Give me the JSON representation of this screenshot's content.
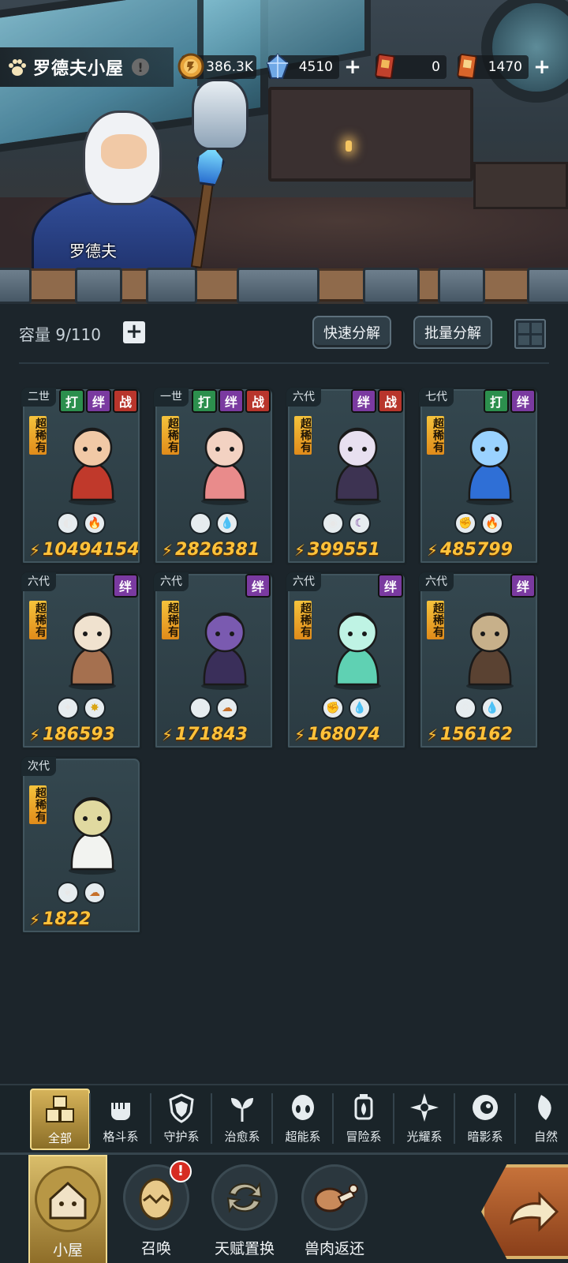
{
  "header": {
    "title": "罗德夫小屋",
    "info_mark": "!"
  },
  "npc": {
    "name": "罗德夫"
  },
  "resources": [
    {
      "icon": "gold-coin-icon",
      "value": "386.3K",
      "has_plus": false
    },
    {
      "icon": "crystal-icon",
      "value": "4510",
      "has_plus": true
    },
    {
      "icon": "red-ticket-icon",
      "value": "0",
      "has_plus": false
    },
    {
      "icon": "orange-ticket-icon",
      "value": "1470",
      "has_plus": true
    }
  ],
  "storage": {
    "label": "容量 9/110",
    "plus": "+",
    "quick_decompose": "快速分解",
    "batch_decompose": "批量分解"
  },
  "cards": [
    {
      "gen": "二世",
      "tags": [
        "打",
        "绊",
        "战"
      ],
      "rarity": "超稀有",
      "attrs": [
        "psychic",
        "fire"
      ],
      "power": "10494154",
      "art": "boy-warrior"
    },
    {
      "gen": "一世",
      "tags": [
        "打",
        "绊",
        "战"
      ],
      "rarity": "超稀有",
      "attrs": [
        "guard",
        "water"
      ],
      "power": "2826381",
      "art": "girl-mage"
    },
    {
      "gen": "六代",
      "tags": [
        "绊",
        "战"
      ],
      "rarity": "超稀有",
      "attrs": [
        "shadow",
        "dark"
      ],
      "power": "399551",
      "art": "fox"
    },
    {
      "gen": "七代",
      "tags": [
        "打",
        "绊"
      ],
      "rarity": "超稀有",
      "attrs": [
        "fist",
        "fire"
      ],
      "power": "485799",
      "art": "blue-flame"
    },
    {
      "gen": "六代",
      "tags": [
        "绊"
      ],
      "rarity": "超稀有",
      "attrs": [
        "radiant",
        "light"
      ],
      "power": "186593",
      "art": "deer"
    },
    {
      "gen": "六代",
      "tags": [
        "绊"
      ],
      "rarity": "超稀有",
      "attrs": [
        "guard",
        "earth"
      ],
      "power": "171843",
      "art": "dark-flower"
    },
    {
      "gen": "六代",
      "tags": [
        "绊"
      ],
      "rarity": "超稀有",
      "attrs": [
        "fist",
        "water"
      ],
      "power": "168074",
      "art": "water-spirit"
    },
    {
      "gen": "六代",
      "tags": [
        "绊"
      ],
      "rarity": "超稀有",
      "attrs": [
        "guard",
        "water"
      ],
      "power": "156162",
      "art": "tree-guardian"
    },
    {
      "gen": "次代",
      "tags": [],
      "rarity": "超稀有",
      "attrs": [
        "heal",
        "earth"
      ],
      "power": "1822",
      "art": "white-owl"
    }
  ],
  "categories": [
    {
      "label": "全部",
      "icon": "all-icon",
      "active": true
    },
    {
      "label": "格斗系",
      "icon": "fist-icon"
    },
    {
      "label": "守护系",
      "icon": "shield-icon"
    },
    {
      "label": "治愈系",
      "icon": "sprout-icon"
    },
    {
      "label": "超能系",
      "icon": "psychic-icon"
    },
    {
      "label": "冒险系",
      "icon": "lantern-icon"
    },
    {
      "label": "光耀系",
      "icon": "radiant-icon"
    },
    {
      "label": "暗影系",
      "icon": "eye-icon"
    },
    {
      "label": "自然",
      "icon": "leaf-icon"
    }
  ],
  "nav": [
    {
      "label": "小屋",
      "icon": "house-icon",
      "active": true
    },
    {
      "label": "召唤",
      "icon": "egg-icon",
      "badge": "!"
    },
    {
      "label": "天赋置换",
      "icon": "swap-icon"
    },
    {
      "label": "兽肉返还",
      "icon": "meat-icon"
    }
  ],
  "colors": {
    "accent_gold": "#ffc23a",
    "tag_fight": "#2c8f4d",
    "tag_bond": "#7a3aa0",
    "tag_war": "#b8352c",
    "rarity": "#f5c33c"
  }
}
